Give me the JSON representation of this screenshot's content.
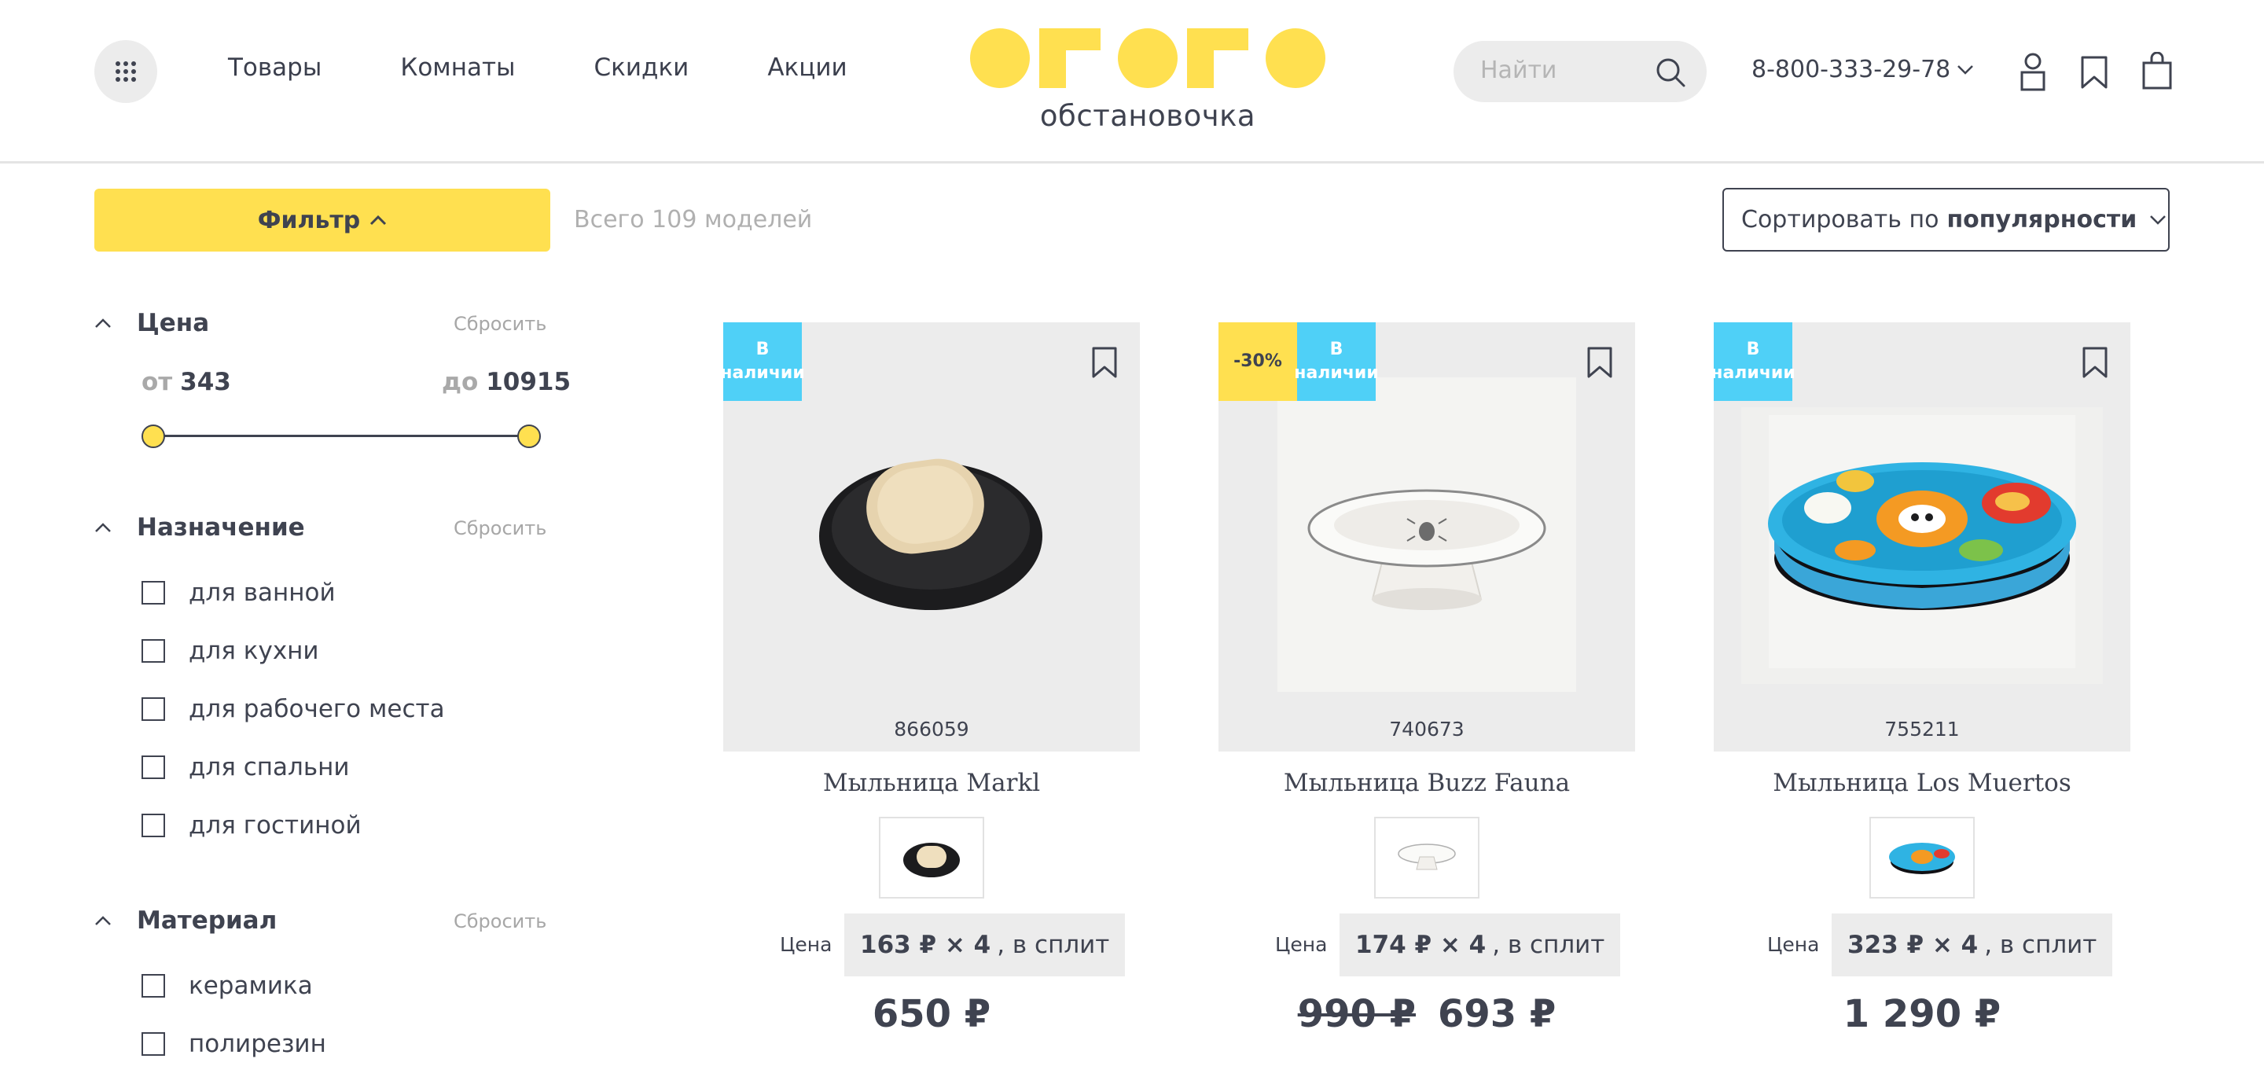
{
  "header": {
    "nav": [
      "Товары",
      "Комнаты",
      "Скидки",
      "Акции"
    ],
    "logo_tagline": "обстановочка",
    "search_placeholder": "Найти",
    "phone": "8-800-333-29-78",
    "accent_color": "#ffe050"
  },
  "toolbar": {
    "filter_label": "Фильтр",
    "total_text": "Всего 109 моделей",
    "sort_prefix": "Сортировать по",
    "sort_value": "популярности"
  },
  "filters": {
    "reset_label": "Сбросить",
    "price": {
      "title": "Цена",
      "from_label": "от",
      "from_value": "343",
      "to_label": "до",
      "to_value": "10915"
    },
    "purpose": {
      "title": "Назначение",
      "options": [
        "для ванной",
        "для кухни",
        "для рабочего места",
        "для спальни",
        "для гостиной"
      ]
    },
    "material": {
      "title": "Материал",
      "options": [
        "керамика",
        "полирезин"
      ]
    }
  },
  "products": [
    {
      "badges": [
        "В наличии"
      ],
      "sku": "866059",
      "title": "Мыльница Markl",
      "price_label": "Цена",
      "split_amount": "163 ₽ × 4",
      "split_suffix": ", в сплит",
      "old_price": "",
      "price": "650 ₽"
    },
    {
      "badges": [
        "-30%",
        "В наличии"
      ],
      "sku": "740673",
      "title": "Мыльница Buzz Fauna",
      "price_label": "Цена",
      "split_amount": "174 ₽ × 4",
      "split_suffix": ", в сплит",
      "old_price": "990 ₽",
      "price": "693 ₽"
    },
    {
      "badges": [
        "В наличии"
      ],
      "sku": "755211",
      "title": "Мыльница Los Muertos",
      "price_label": "Цена",
      "split_amount": "323 ₽ × 4",
      "split_suffix": ", в сплит",
      "old_price": "",
      "price": "1 290 ₽"
    }
  ]
}
